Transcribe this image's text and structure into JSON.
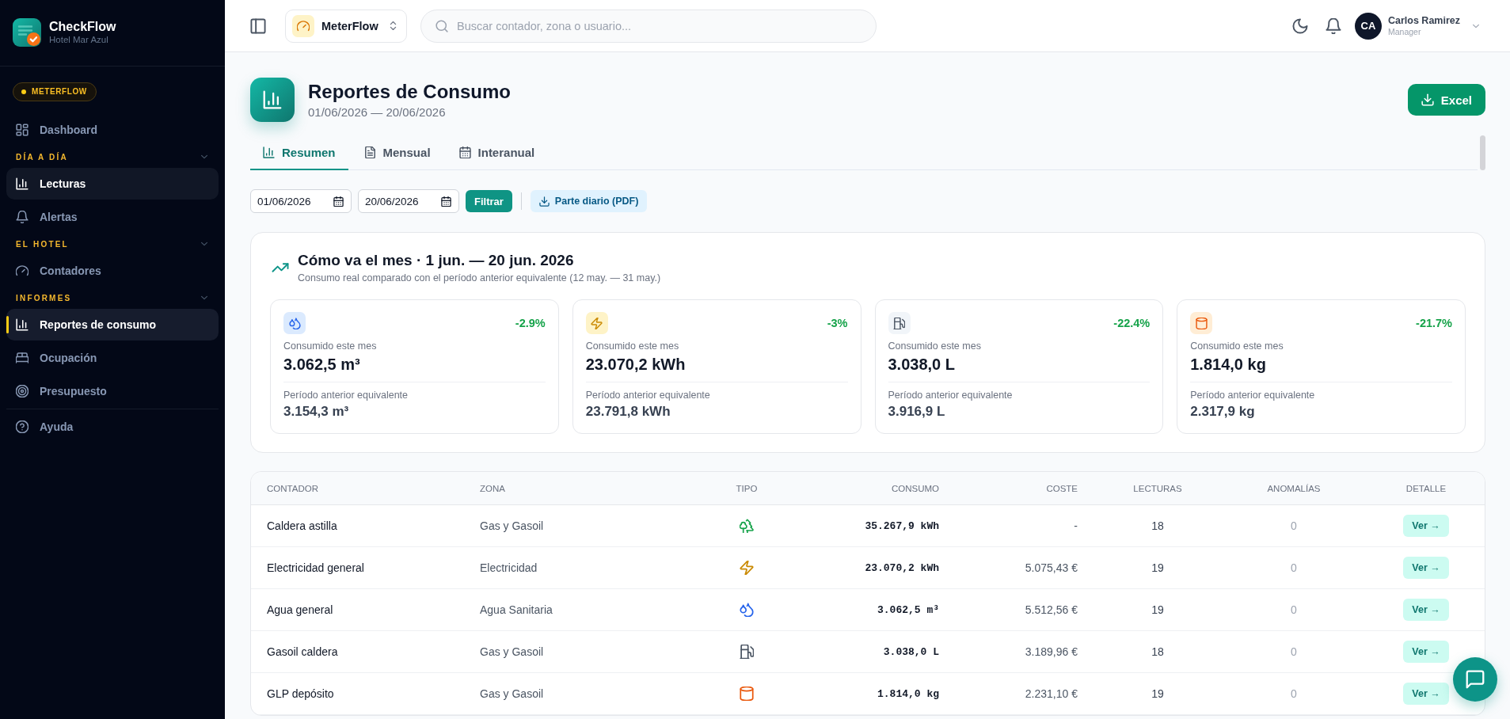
{
  "sidebar": {
    "brand": {
      "name": "CheckFlow",
      "subtitle": "Hotel Mar Azul"
    },
    "badge": "METERFLOW",
    "nav": [
      {
        "kind": "link",
        "label": "Dashboard",
        "selected": false,
        "hovered": false
      },
      {
        "kind": "group",
        "label": "DÍA A DÍA",
        "expanded": true,
        "children": [
          {
            "label": "Lecturas",
            "selected": false,
            "hovered": true
          },
          {
            "label": "Alertas",
            "selected": false,
            "hovered": false
          }
        ]
      },
      {
        "kind": "group",
        "label": "EL HOTEL",
        "expanded": true,
        "children": [
          {
            "label": "Contadores",
            "selected": false,
            "hovered": false
          }
        ]
      },
      {
        "kind": "group",
        "label": "INFORMES",
        "expanded": true,
        "children": [
          {
            "label": "Reportes de consumo",
            "selected": true,
            "hovered": false
          },
          {
            "label": "Ocupación",
            "selected": false,
            "hovered": false
          },
          {
            "label": "Presupuesto",
            "selected": false,
            "hovered": false
          }
        ]
      }
    ],
    "footer_nav": [
      {
        "label": "Ayuda",
        "selected": false,
        "hovered": false
      }
    ]
  },
  "topbar": {
    "app_switcher": "MeterFlow",
    "search": {
      "placeholder": "Buscar contador, zona o usuario..."
    },
    "user": {
      "initials": "CA",
      "name": "Carlos Ramirez",
      "role": "Manager"
    }
  },
  "header": {
    "title": "Reportes de Consumo",
    "date_range": "01/06/2026 — 20/06/2026",
    "export_button": "Excel"
  },
  "tabs": [
    {
      "label": "Resumen",
      "selected": true
    },
    {
      "label": "Mensual",
      "selected": false
    },
    {
      "label": "Interanual",
      "selected": false
    }
  ],
  "filters": {
    "date_from": "01/06/2026",
    "date_to": "20/06/2026",
    "filter_button": "Filtrar",
    "pdf_button": "Parte diario (PDF)"
  },
  "summary": {
    "title": "Cómo va el mes · 1 jun. — 20 jun. 2026",
    "subtitle": "Consumo real comparado con el período anterior equivalente (12 may. — 31 may.)",
    "metrics": [
      {
        "kind": "water",
        "change": "-2.9%",
        "current_label": "Consumido este mes",
        "current_value": "3.062,5 m³",
        "previous_label": "Período anterior equivalente",
        "previous_value": "3.154,3 m³"
      },
      {
        "kind": "electricity",
        "change": "-3%",
        "current_label": "Consumido este mes",
        "current_value": "23.070,2 kWh",
        "previous_label": "Período anterior equivalente",
        "previous_value": "23.791,8 kWh"
      },
      {
        "kind": "diesel",
        "change": "-22.4%",
        "current_label": "Consumido este mes",
        "current_value": "3.038,0 L",
        "previous_label": "Período anterior equivalente",
        "previous_value": "3.916,9 L"
      },
      {
        "kind": "lpg",
        "change": "-21.7%",
        "current_label": "Consumido este mes",
        "current_value": "1.814,0 kg",
        "previous_label": "Período anterior equivalente",
        "previous_value": "2.317,9 kg"
      }
    ]
  },
  "table": {
    "columns": [
      "CONTADOR",
      "ZONA",
      "TIPO",
      "CONSUMO",
      "COSTE",
      "LECTURAS",
      "ANOMALÍAS",
      "DETALLE"
    ],
    "rows": [
      {
        "name": "Caldera astilla",
        "zone": "Gas y Gasoil",
        "kind": "biomass",
        "consumption": "35.267,9 kWh",
        "cost": "-",
        "readings": "18",
        "anomalies": "0",
        "action": "Ver →"
      },
      {
        "name": "Electricidad general",
        "zone": "Electricidad",
        "kind": "electricity",
        "consumption": "23.070,2 kWh",
        "cost": "5.075,43 €",
        "readings": "19",
        "anomalies": "0",
        "action": "Ver →"
      },
      {
        "name": "Agua general",
        "zone": "Agua Sanitaria",
        "kind": "water",
        "consumption": "3.062,5 m³",
        "cost": "5.512,56 €",
        "readings": "19",
        "anomalies": "0",
        "action": "Ver →"
      },
      {
        "name": "Gasoil caldera",
        "zone": "Gas y Gasoil",
        "kind": "diesel",
        "consumption": "3.038,0 L",
        "cost": "3.189,96 €",
        "readings": "18",
        "anomalies": "0",
        "action": "Ver →"
      },
      {
        "name": "GLP depósito",
        "zone": "Gas y Gasoil",
        "kind": "lpg",
        "consumption": "1.814,0 kg",
        "cost": "2.231,10 €",
        "readings": "19",
        "anomalies": "0",
        "action": "Ver →"
      }
    ]
  }
}
